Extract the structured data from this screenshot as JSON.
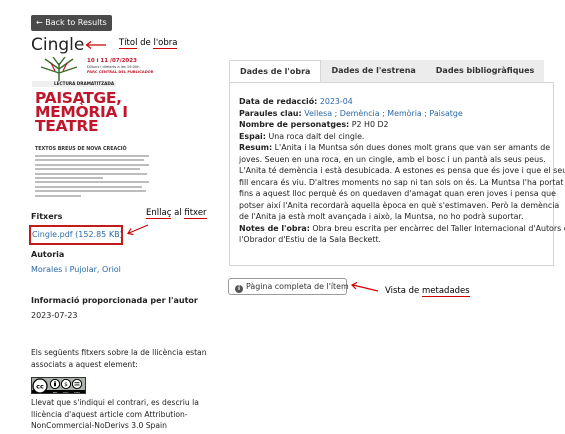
{
  "back_button": {
    "label": "Back to Results",
    "icon": "arrow-left-icon"
  },
  "page_title": "Cingle",
  "annotations": {
    "title": {
      "part1": "Títol",
      "part2": " de ",
      "part3": "l'obra"
    },
    "link": {
      "part1": "Enllaç",
      "part2": " al ",
      "part3": "fitxer"
    },
    "metadata": {
      "part1": "Vista de ",
      "part2": "metadades"
    }
  },
  "cover": {
    "date": "10 i 11 /07/2023",
    "line1": "Dilluns i dimarts a les 19.00h",
    "line2": "PARC CENTRAL DEL PUBLICADOR",
    "tag": "LECTURA DRAMATITZADA",
    "big_title": [
      "PAISATGE,",
      "MEMÒRIA I",
      "TEATRE"
    ],
    "subtitle": "TEXTOS BREUS DE NOVA CREACIÓ"
  },
  "files": {
    "label": "Fitxers",
    "file_link": "Cingle.pdf (152.85 KB)"
  },
  "authorship": {
    "label": "Autoria",
    "author": "Morales i Pujolar, Oriol"
  },
  "author_info": {
    "label": "Informació proporcionada per l'autor",
    "date": "2023-07-23"
  },
  "license": {
    "intro": [
      "Els següents fitxers sobre la de llicència estan",
      "associats a aquest element:"
    ],
    "badge": {
      "cc": "cc",
      "by": "BY",
      "nc": "NC",
      "nd": "ND"
    },
    "text": [
      "Llevat que s'indiqui el contrari, es descriu la",
      "llicència d'aquest article com Attribution-",
      "NonCommercial-NoDerivs 3.0 Spain"
    ]
  },
  "tabs": [
    {
      "label": "Dades de l'obra",
      "active": true
    },
    {
      "label": "Dades de l'estrena",
      "active": false
    },
    {
      "label": "Dades bibliogràfiques",
      "active": false
    }
  ],
  "metadata": {
    "date_label": "Data de redacció:",
    "date_value": "2023-04",
    "keywords_label": "Paraules clau:",
    "keywords": [
      "Vellesa",
      "Demència",
      "Memòria",
      "Paisatge"
    ],
    "characters_label": "Nombre de personatges:",
    "characters_value": "P2 H0 D2",
    "space_label": "Espai:",
    "space_value": "Una roca dalt del cingle.",
    "summary_label": "Resum:",
    "summary_lines": [
      "L'Anita i la Muntsa són dues dones molt grans que van ser amants de",
      "joves. Seuen en una roca, en un cingle, amb el bosc i un pantà als seus peus.",
      "L'Anita té demència i està desubicada. A estones es pensa que és jove i que el seu",
      "fill encara és viu. D'altres moments no sap ni tan sols on és. La Muntsa l'ha portat",
      "fins a aquest lloc perquè és on quedaven d'amagat quan eren joves i pensa que",
      "potser així l'Anita recordarà aquella època en què s'estimaven. Però la demència",
      "de l'Anita ja està molt avançada i això, la Muntsa, no ho podrà suportar."
    ],
    "notes_label": "Notes de l'obra:",
    "notes_lines": [
      "Obra breu escrita per encàrrec del Taller Internacional d'Autors de",
      "l'Obrador d'Estiu de la Sala Beckett."
    ]
  },
  "full_record_button": {
    "label": "Pàgina completa de l'ítem",
    "icon": "info-icon"
  },
  "colors": {
    "accent": "#2b6aa6",
    "annotation_red": "#cc0000",
    "cover_red": "#c0162c"
  }
}
